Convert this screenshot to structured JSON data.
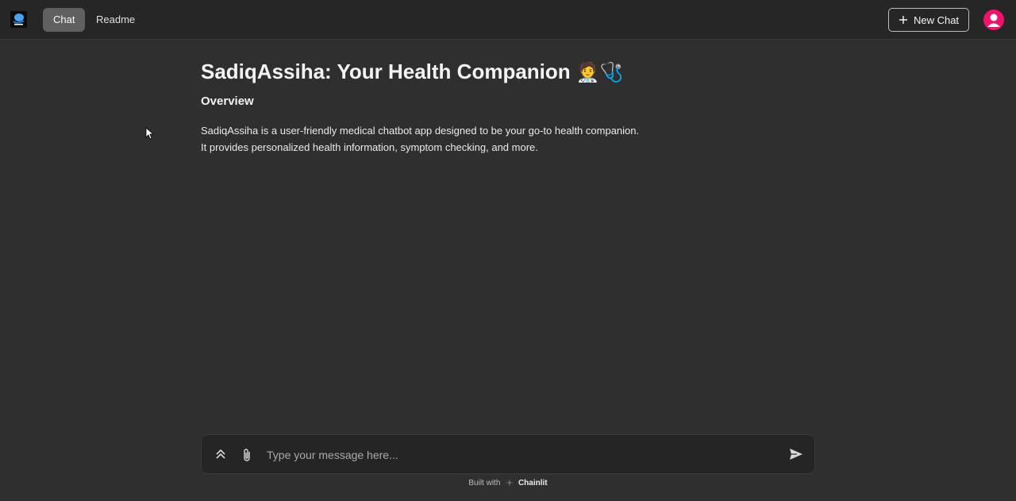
{
  "header": {
    "logo_icon": "app-logo-icon",
    "tabs": [
      {
        "label": "Chat",
        "active": true
      },
      {
        "label": "Readme",
        "active": false
      }
    ],
    "new_chat_label": "New Chat",
    "avatar_color": "#f2116c"
  },
  "main": {
    "title": "SadiqAssiha: Your Health Companion",
    "title_emojis": "🧑‍⚕️🩺",
    "subtitle": "Overview",
    "description_lines": [
      "SadiqAssiha is a user-friendly medical chatbot app designed to be your go-to health companion.",
      "It provides personalized health information, symptom checking, and more."
    ]
  },
  "composer": {
    "placeholder": "Type your message here...",
    "value": ""
  },
  "footer": {
    "built_with": "Built with",
    "brand": "Chainlit"
  }
}
